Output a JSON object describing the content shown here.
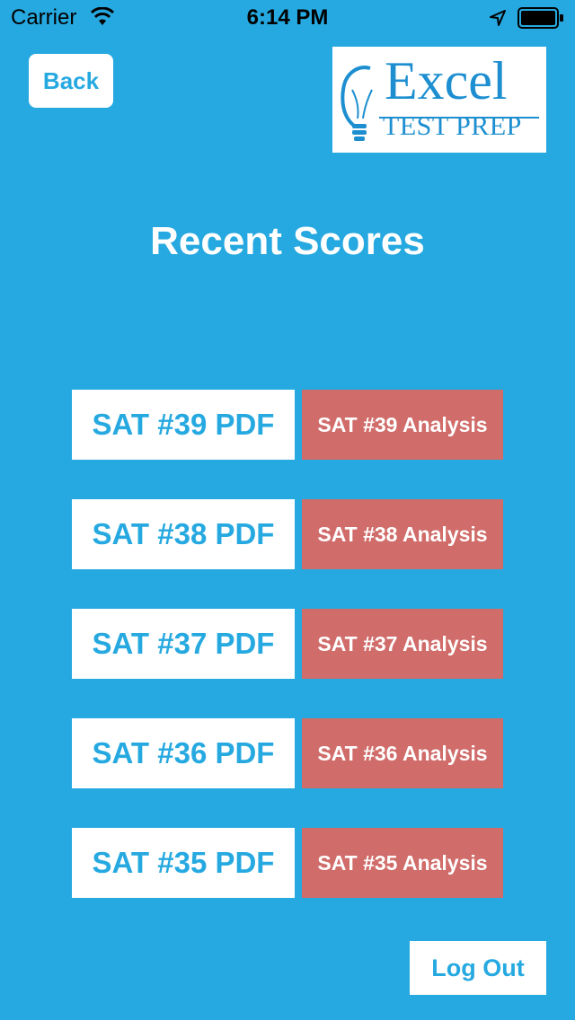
{
  "status_bar": {
    "carrier": "Carrier",
    "time": "6:14 PM"
  },
  "header": {
    "back_label": "Back",
    "logo_word1": "Excel",
    "logo_word2": "TEST PREP"
  },
  "title": "Recent Scores",
  "scores": [
    {
      "pdf_label": "SAT #39 PDF",
      "analysis_label": "SAT #39 Analysis"
    },
    {
      "pdf_label": "SAT #38 PDF",
      "analysis_label": "SAT #38 Analysis"
    },
    {
      "pdf_label": "SAT #37 PDF",
      "analysis_label": "SAT #37 Analysis"
    },
    {
      "pdf_label": "SAT #36 PDF",
      "analysis_label": "SAT #36 Analysis"
    },
    {
      "pdf_label": "SAT #35 PDF",
      "analysis_label": "SAT #35 Analysis"
    }
  ],
  "logout_label": "Log Out",
  "colors": {
    "background": "#26a9e0",
    "analysis": "#d06c6a",
    "button": "#ffffff"
  },
  "icons": [
    "wifi-icon",
    "location-icon",
    "battery-icon",
    "lightbulb-icon"
  ]
}
